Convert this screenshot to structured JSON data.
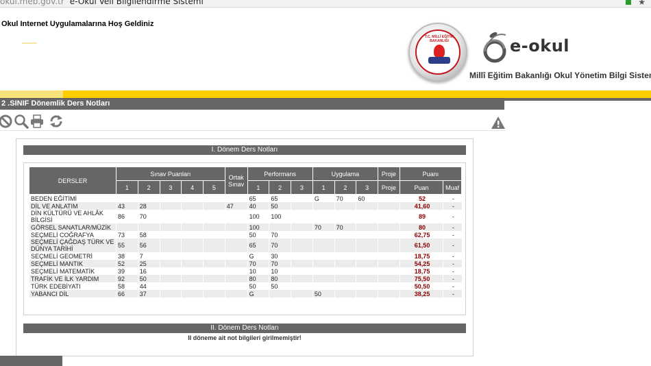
{
  "browser": {
    "url": "okul.meb.gov.tr",
    "tab_title": "e-Okul Veli Bilgilendirme Sistemi"
  },
  "header": {
    "welcome": "Okul Internet Uygulamalarına Hoş Geldiniz",
    "logo_text": "e-okul",
    "ministry_text": "Millî Eğitim Bakanlığı Okul Yönetim Bilgi Sistemi",
    "seal_text": "T.C. MİLLÎ EĞİTİM BAKANLIĞI"
  },
  "page": {
    "title": "2 .SINIF Dönemlik Ders Notları"
  },
  "toolbar": {
    "icons": [
      "cancel-icon",
      "search-icon",
      "print-icon",
      "refresh-icon",
      "warning-icon"
    ]
  },
  "colors": {
    "accent_yellow": "#ffcc00",
    "header_gray": "#666666",
    "grade_red": "#8b0000"
  },
  "term1": {
    "title": "I. Dönem Ders Notları",
    "headers": {
      "dersler": "DERSLER",
      "sinav": "Sınav Puanları",
      "performans": "Performans",
      "uygulama": "Uygulama",
      "proje": "Proje",
      "puani": "Puanı",
      "sinav_cols": [
        "1",
        "2",
        "3",
        "4",
        "5",
        "Ortak Sınav"
      ],
      "perf_cols": [
        "1",
        "2",
        "3"
      ],
      "uyg_cols": [
        "1",
        "2",
        "3"
      ],
      "proje_col": "Proje",
      "puan_col": "Puan",
      "muaf_col": "Muaf"
    },
    "rows": [
      {
        "ders": "BEDEN EĞİTİMİ",
        "s": [
          "",
          "",
          "",
          "",
          "",
          ""
        ],
        "p": [
          "65",
          "65",
          ""
        ],
        "u": [
          "G",
          "70",
          "60"
        ],
        "proje": "",
        "puan": "52",
        "muaf": "-"
      },
      {
        "ders": "DİL VE ANLATIM",
        "s": [
          "43",
          "28",
          "",
          "",
          "",
          "47"
        ],
        "p": [
          "40",
          "50",
          ""
        ],
        "u": [
          "",
          "",
          ""
        ],
        "proje": "",
        "puan": "41,60",
        "muaf": "-"
      },
      {
        "ders": "DİN KÜLTÜRÜ VE AHLÂK BİLGİSİ",
        "s": [
          "86",
          "70",
          "",
          "",
          "",
          ""
        ],
        "p": [
          "100",
          "100",
          ""
        ],
        "u": [
          "",
          "",
          ""
        ],
        "proje": "",
        "puan": "89",
        "muaf": "-"
      },
      {
        "ders": "GÖRSEL SANATLAR/MÜZİK",
        "s": [
          "",
          "",
          "",
          "",
          "",
          ""
        ],
        "p": [
          "100",
          "",
          ""
        ],
        "u": [
          "70",
          "70",
          ""
        ],
        "proje": "",
        "puan": "80",
        "muaf": "-"
      },
      {
        "ders": "SEÇMELİ COĞRAFYA",
        "s": [
          "73",
          "58",
          "",
          "",
          "",
          ""
        ],
        "p": [
          "50",
          "70",
          ""
        ],
        "u": [
          "",
          "",
          ""
        ],
        "proje": "",
        "puan": "62,75",
        "muaf": "-"
      },
      {
        "ders": "SEÇMELİ ÇAĞDAŞ TÜRK VE DÜNYA TARİHİ",
        "s": [
          "55",
          "56",
          "",
          "",
          "",
          ""
        ],
        "p": [
          "65",
          "70",
          ""
        ],
        "u": [
          "",
          "",
          ""
        ],
        "proje": "",
        "puan": "61,50",
        "muaf": "-"
      },
      {
        "ders": "SEÇMELİ GEOMETRİ",
        "s": [
          "38",
          "7",
          "",
          "",
          "",
          ""
        ],
        "p": [
          "G",
          "30",
          ""
        ],
        "u": [
          "",
          "",
          ""
        ],
        "proje": "",
        "puan": "18,75",
        "muaf": "-"
      },
      {
        "ders": "SEÇMELİ MANTIK",
        "s": [
          "52",
          "25",
          "",
          "",
          "",
          ""
        ],
        "p": [
          "70",
          "70",
          ""
        ],
        "u": [
          "",
          "",
          ""
        ],
        "proje": "",
        "puan": "54,25",
        "muaf": "-"
      },
      {
        "ders": "SEÇMELİ MATEMATİK",
        "s": [
          "39",
          "16",
          "",
          "",
          "",
          ""
        ],
        "p": [
          "10",
          "10",
          ""
        ],
        "u": [
          "",
          "",
          ""
        ],
        "proje": "",
        "puan": "18,75",
        "muaf": "-"
      },
      {
        "ders": "TRAFİK VE İLK YARDIM",
        "s": [
          "92",
          "50",
          "",
          "",
          "",
          ""
        ],
        "p": [
          "80",
          "80",
          ""
        ],
        "u": [
          "",
          "",
          ""
        ],
        "proje": "",
        "puan": "75,50",
        "muaf": "-"
      },
      {
        "ders": "TÜRK EDEBİYATI",
        "s": [
          "58",
          "44",
          "",
          "",
          "",
          ""
        ],
        "p": [
          "50",
          "50",
          ""
        ],
        "u": [
          "",
          "",
          ""
        ],
        "proje": "",
        "puan": "50,50",
        "muaf": "-"
      },
      {
        "ders": "YABANCI DİL",
        "s": [
          "66",
          "37",
          "",
          "",
          "",
          ""
        ],
        "p": [
          "G",
          "",
          ""
        ],
        "u": [
          "50",
          "",
          ""
        ],
        "proje": "",
        "puan": "38,25",
        "muaf": "-"
      }
    ]
  },
  "term2": {
    "title": "II. Dönem Ders Notları",
    "message": "II döneme ait not bilgileri girilmemiştir!"
  }
}
